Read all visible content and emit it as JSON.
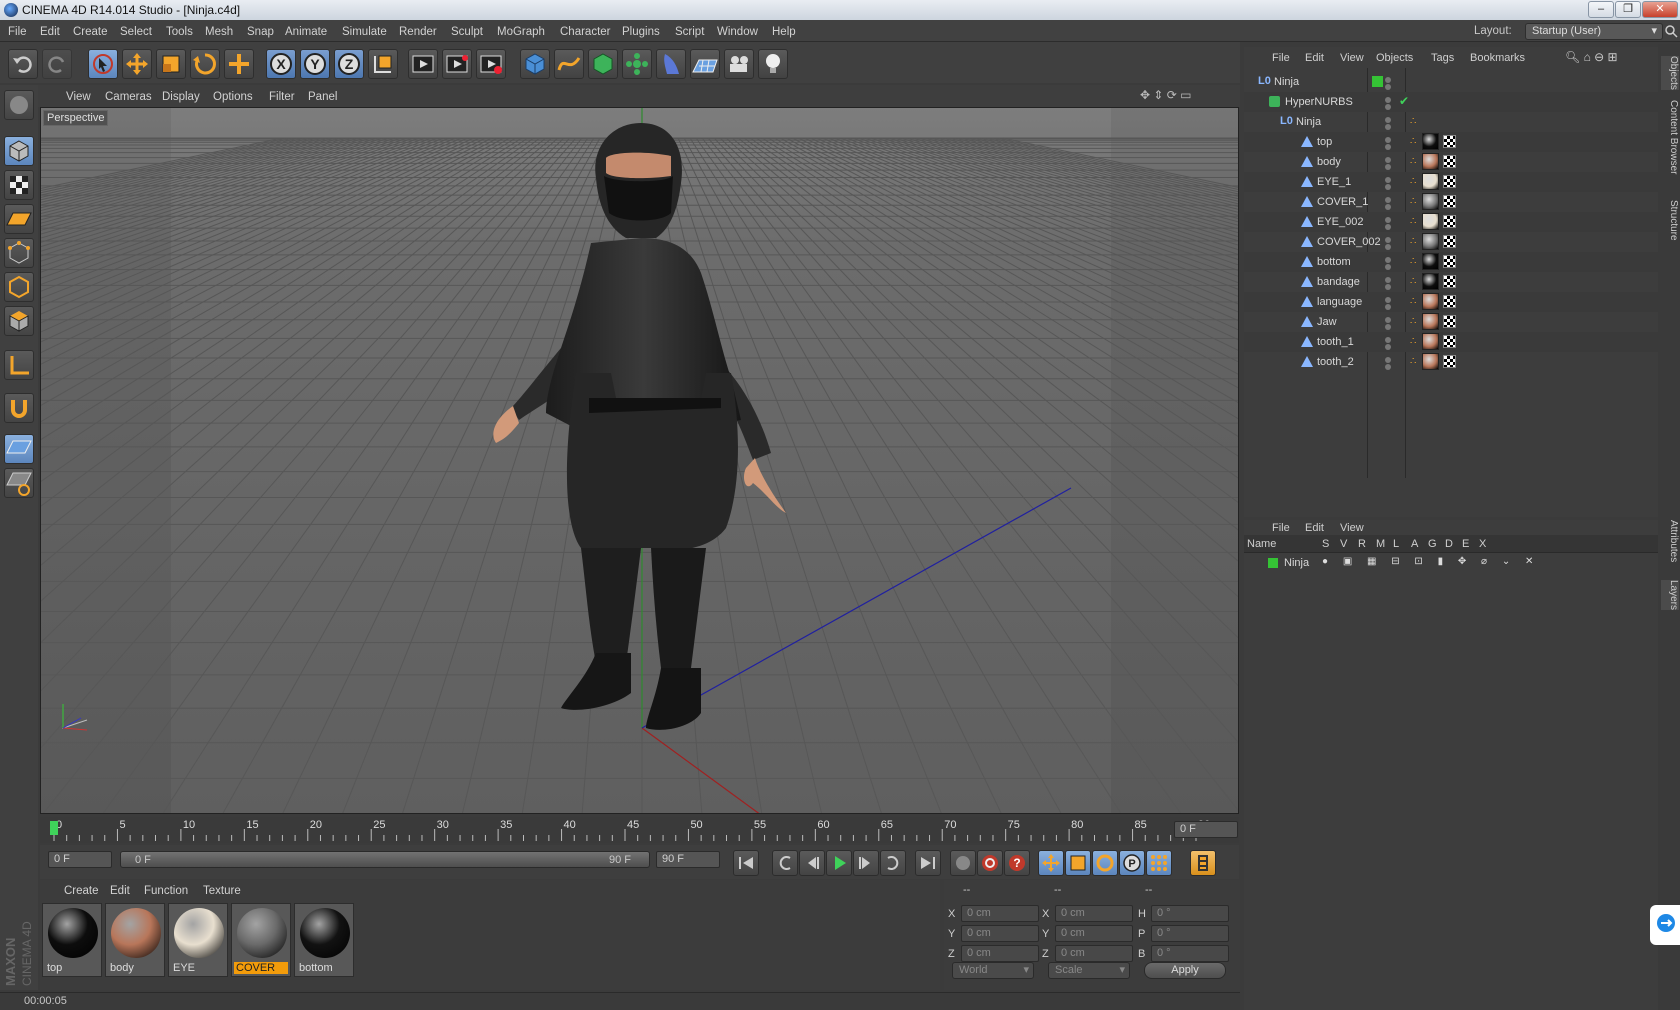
{
  "window": {
    "title": "CINEMA 4D R14.014 Studio - [Ninja.c4d]",
    "layout_label": "Layout:",
    "layout_value": "Startup (User)"
  },
  "menu": [
    "File",
    "Edit",
    "Create",
    "Select",
    "Tools",
    "Mesh",
    "Snap",
    "Animate",
    "Simulate",
    "Render",
    "Sculpt",
    "MoGraph",
    "Character",
    "Plugins",
    "Script",
    "Window",
    "Help"
  ],
  "viewport": {
    "menu": [
      "View",
      "Cameras",
      "Display",
      "Options",
      "Filter",
      "Panel"
    ],
    "label": "Perspective"
  },
  "timeline": {
    "ticks": [
      "0",
      "5",
      "10",
      "15",
      "20",
      "25",
      "30",
      "35",
      "40",
      "45",
      "50",
      "55",
      "60",
      "65",
      "70",
      "75",
      "80",
      "85",
      "90"
    ],
    "frame_field": "0 F"
  },
  "timecontrols": {
    "start": "0 F",
    "range_start": "0 F",
    "range_end": "90 F",
    "end": "90 F"
  },
  "materials": {
    "menu": [
      "Create",
      "Edit",
      "Function",
      "Texture"
    ],
    "items": [
      {
        "name": "top",
        "color": "#0d0d0d"
      },
      {
        "name": "body",
        "color": "#b8765a"
      },
      {
        "name": "EYE",
        "color": "#e8dfcf"
      },
      {
        "name": "COVER",
        "color": "#6a6a6a",
        "selected": true
      },
      {
        "name": "bottom",
        "color": "#121212"
      }
    ]
  },
  "coords": {
    "headers": [
      "--",
      "--",
      "--"
    ],
    "rows": [
      {
        "a": "X",
        "av": "0 cm",
        "b": "X",
        "bv": "0 cm",
        "c": "H",
        "cv": "0 °"
      },
      {
        "a": "Y",
        "av": "0 cm",
        "b": "Y",
        "bv": "0 cm",
        "c": "P",
        "cv": "0 °"
      },
      {
        "a": "Z",
        "av": "0 cm",
        "b": "Z",
        "bv": "0 cm",
        "c": "B",
        "cv": "0 °"
      }
    ],
    "space": "World",
    "mode": "Scale",
    "apply": "Apply"
  },
  "status": {
    "time": "00:00:05"
  },
  "objects": {
    "menu": [
      "File",
      "Edit",
      "View",
      "Objects",
      "Tags",
      "Bookmarks"
    ],
    "tree": [
      {
        "name": "Ninja",
        "level": 0,
        "type": "null"
      },
      {
        "name": "HyperNURBS",
        "level": 1,
        "type": "nurbs"
      },
      {
        "name": "Ninja",
        "level": 2,
        "type": "null"
      },
      {
        "name": "top",
        "level": 3,
        "type": "poly",
        "mat": "#0d0d0d"
      },
      {
        "name": "body",
        "level": 3,
        "type": "poly",
        "mat": "#b8765a"
      },
      {
        "name": "EYE_1",
        "level": 3,
        "type": "poly",
        "mat": "#e8dfcf"
      },
      {
        "name": "COVER_1",
        "level": 3,
        "type": "poly",
        "mat": "#777"
      },
      {
        "name": "EYE_002",
        "level": 3,
        "type": "poly",
        "mat": "#e8dfcf"
      },
      {
        "name": "COVER_002",
        "level": 3,
        "type": "poly",
        "mat": "#777"
      },
      {
        "name": "bottom",
        "level": 3,
        "type": "poly",
        "mat": "#0d0d0d"
      },
      {
        "name": "bandage",
        "level": 3,
        "type": "poly",
        "mat": "#0d0d0d"
      },
      {
        "name": "language",
        "level": 3,
        "type": "poly",
        "mat": "#b8765a"
      },
      {
        "name": "Jaw",
        "level": 3,
        "type": "poly",
        "mat": "#b8765a"
      },
      {
        "name": "tooth_1",
        "level": 3,
        "type": "poly",
        "mat": "#b8765a"
      },
      {
        "name": "tooth_2",
        "level": 3,
        "type": "poly",
        "mat": "#b8765a"
      }
    ]
  },
  "layers": {
    "menu": [
      "File",
      "Edit",
      "View"
    ],
    "columns": [
      "Name",
      "S",
      "V",
      "R",
      "M",
      "L",
      "A",
      "G",
      "D",
      "E",
      "X"
    ],
    "rows": [
      {
        "name": "Ninja",
        "color": "#35c335"
      }
    ]
  },
  "sidetabs": [
    "Objects",
    "Content Browser",
    "Structure",
    "Attributes",
    "Layers"
  ],
  "brand": {
    "maxon": "MAXON",
    "product": "CINEMA 4D"
  }
}
